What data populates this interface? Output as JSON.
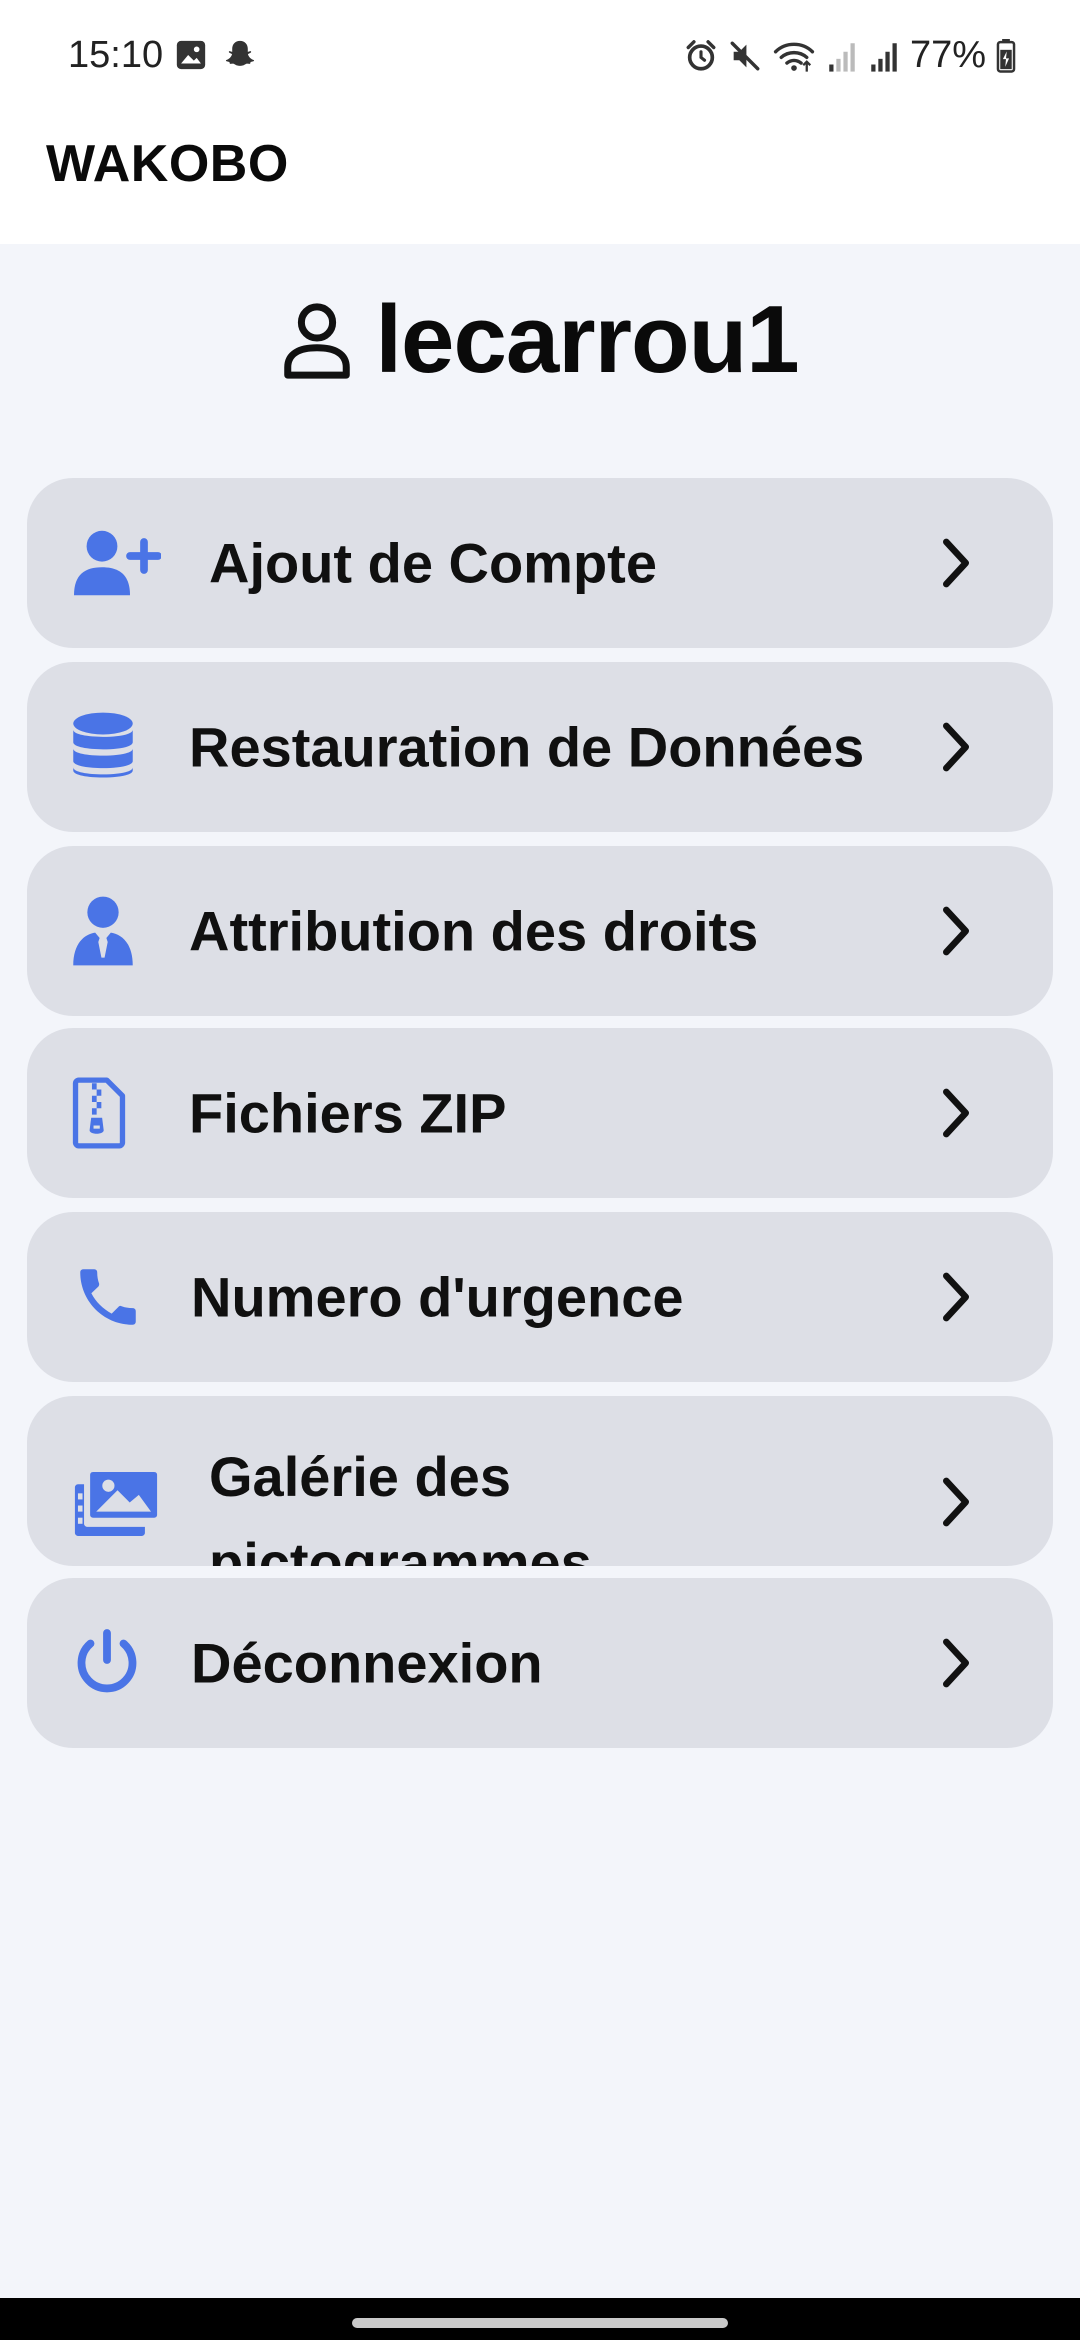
{
  "status_bar": {
    "time": "15:10",
    "battery": "77%",
    "left_icons": [
      "image-icon",
      "snapchat-icon"
    ],
    "right_icons": [
      "alarm-icon",
      "mute-icon",
      "wifi-icon",
      "signal-icon",
      "signal-icon",
      "battery-icon"
    ]
  },
  "app": {
    "title": "WAKOBO"
  },
  "user": {
    "name": "lecarrou1",
    "icon": "person-outline-icon"
  },
  "menu": {
    "items": [
      {
        "label": "Ajout de Compte",
        "icon": "user-plus-icon"
      },
      {
        "label": "Restauration de Données",
        "icon": "database-icon"
      },
      {
        "label": "Attribution des droits",
        "icon": "user-tie-icon"
      },
      {
        "label": "Fichiers ZIP",
        "icon": "zip-file-icon"
      },
      {
        "label": "Numero d'urgence",
        "icon": "phone-icon"
      },
      {
        "label": "Galérie des pictogrammes",
        "icon": "photo-gallery-icon"
      },
      {
        "label": "Déconnexion",
        "icon": "power-icon"
      }
    ]
  },
  "colors": {
    "accent": "#4a74e6",
    "item_background": "#dddfe6",
    "page_background": "#f3f5fa"
  }
}
